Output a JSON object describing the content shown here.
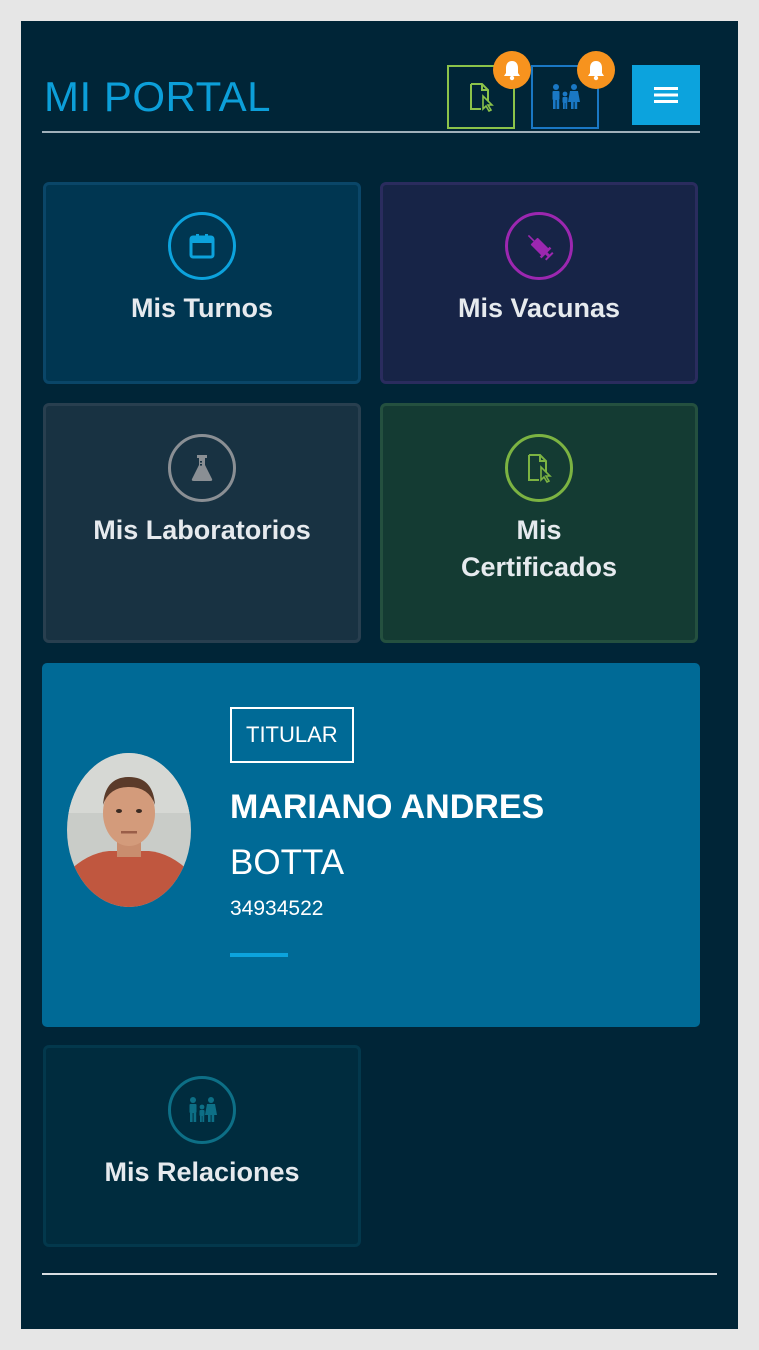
{
  "header": {
    "title": "MI PORTAL"
  },
  "tiles": {
    "turnos": {
      "label": "Mis Turnos"
    },
    "vacunas": {
      "label": "Mis Vacunas"
    },
    "laboratorios": {
      "label": "Mis Laboratorios"
    },
    "certificados": {
      "label": "Mis Certificados"
    },
    "relaciones": {
      "label": "Mis Relaciones"
    }
  },
  "profile": {
    "badge": "TITULAR",
    "first_names": "MARIANO ANDRES",
    "surname": "BOTTA",
    "document": "34934522"
  },
  "icons": {
    "header": [
      "certificate-icon",
      "family-icon",
      "bell-icon",
      "menu-icon"
    ],
    "tiles": [
      "calendar-icon",
      "syringe-icon",
      "flask-icon",
      "certificate-icon",
      "family-icon"
    ]
  },
  "colors": {
    "background": "#002537",
    "accent": "#0ca3dd",
    "notification": "#f7931e",
    "profile_card": "#006a96"
  }
}
